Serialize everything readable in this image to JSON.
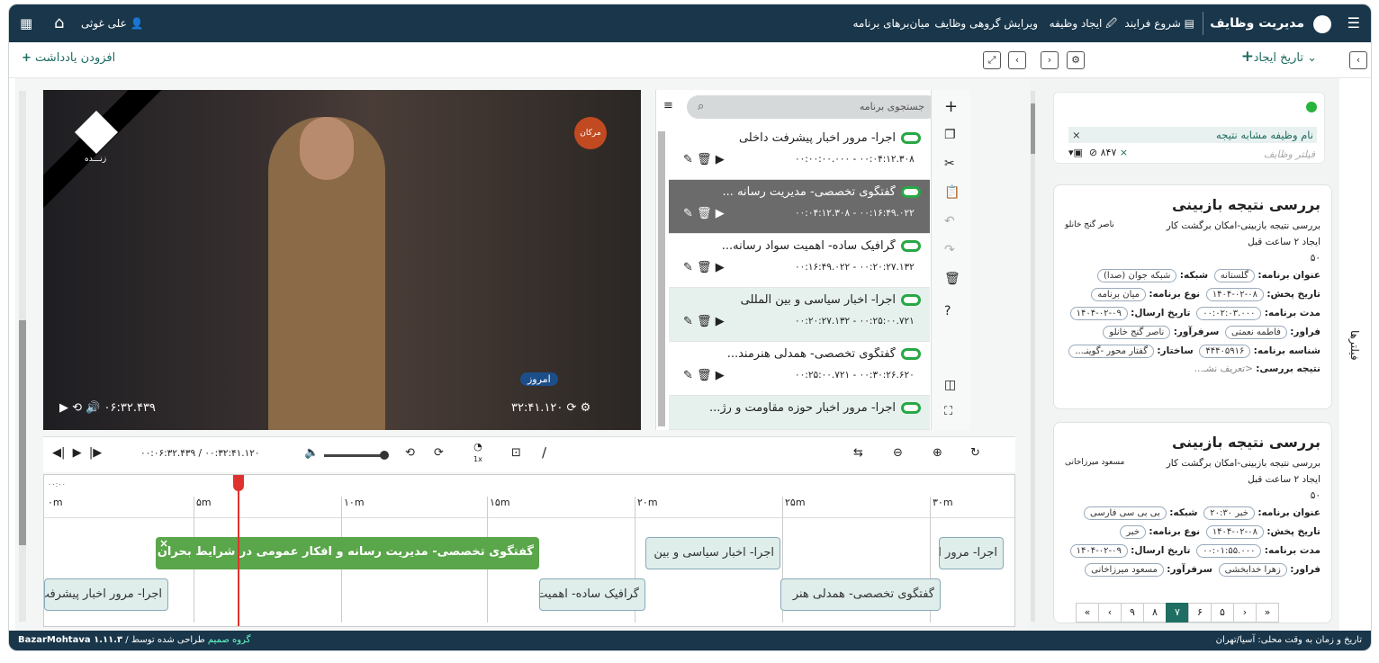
{
  "topbar": {
    "app_title": "مدیریت وظایف",
    "menu": [
      "شروع فرایند",
      "ایجاد وظیفه",
      "ویرایش گروهی وظایف",
      "میان‌برهای برنامه"
    ],
    "user": "علی غوثی"
  },
  "sub": {
    "sort_label": "تاریخ ایجاد",
    "add_note": "افزودن یادداشت"
  },
  "filters_rail": "فیلترها",
  "filter": {
    "tags": "نام وظیفه  مشابه  نتیجه",
    "placeholder": "فیلتر وظایف",
    "count": "۸۴۷"
  },
  "cards": [
    {
      "title": "بررسی نتیجه بازبینی",
      "subtitle": "بررسی نتیجه بازبینی-امکان برگشت کار",
      "person": "ناصر گنج خانلو",
      "created": "ایجاد ۲ ساعت قبل",
      "score": "۵۰",
      "l_program": "عنوان برنامه:",
      "v_program": "گلستانه",
      "l_network": "شبکه:",
      "v_network": "شبکه جوان (صدا)",
      "l_date": "تاریخ پخش:",
      "v_date": "۱۴۰۴-۰۲-۰۸",
      "l_type": "نوع برنامه:",
      "v_type": "میان برنامه",
      "l_dur": "مدت برنامه:",
      "v_dur": "۰۰:۰۲:۰۳.۰۰۰",
      "l_send": "تاریخ ارسال:",
      "v_send": "۱۴۰۴-۰۲-۰۹",
      "l_flow": "فراور:",
      "v_flow": "فاطمه نعمتی",
      "l_lead": "سرفرآور:",
      "v_lead": "ناصر گنج خانلو",
      "l_id": "شناسه برنامه:",
      "v_id": "۴۴۴۰۵۹۱۶",
      "l_struct": "ساختار:",
      "v_struct": "گفتار محور -گوینـ...",
      "l_result": "نتیجه بررسی:",
      "v_result": "<تعریف نشـ..."
    },
    {
      "title": "بررسی نتیجه بازبینی",
      "subtitle": "بررسی نتیجه بازبینی-امکان برگشت کار",
      "person": "مسعود میرزاخانی",
      "created": "ایجاد ۲ ساعت قبل",
      "score": "۵۰",
      "l_program": "عنوان برنامه:",
      "v_program": "خبر ۲۰:۳۰",
      "l_network": "شبکه:",
      "v_network": "بی بی سی فارسی",
      "l_date": "تاریخ پخش:",
      "v_date": "۱۴۰۴-۰۲-۰۸",
      "l_type": "نوع برنامه:",
      "v_type": "خبر",
      "l_dur": "مدت برنامه:",
      "v_dur": "۰۰:۰۱:۵۵.۰۰۰",
      "l_send": "تاریخ ارسال:",
      "v_send": "۱۴۰۴-۰۲-۰۹",
      "l_flow": "فراور:",
      "v_flow": "زهرا خدابخشی",
      "l_lead": "سرفرآور:",
      "v_lead": "مسعود میرزاخانی"
    }
  ],
  "pager": [
    "«",
    "‹",
    "۹",
    "۸",
    "۷",
    "۶",
    "۵",
    "›",
    "»"
  ],
  "video": {
    "live": "زنـــده",
    "time_left": "۰۶:۳۲.۴۳۹",
    "time_right": "۳۲:۴۱.۱۲۰",
    "logo_right": "مرکان",
    "logo_br": "امروز"
  },
  "search": {
    "placeholder": "جستجوی برنامه"
  },
  "playlist": [
    {
      "title": "اجرا- مرور اخبار پیشرفت داخلی",
      "time": "۰۰:۰۰:۰۰.۰۰۰  -  ۰۰:۰۴:۱۲.۳۰۸"
    },
    {
      "title": "گفتگوی تخصصی- مدیریت رسانه ...",
      "time": "۰۰:۰۴:۱۲.۳۰۸  -  ۰۰:۱۶:۴۹.۰۲۲"
    },
    {
      "title": "گرافیک ساده- اهمیت سواد رسانه...",
      "time": "۰۰:۱۶:۴۹.۰۲۲  -  ۰۰:۲۰:۲۷.۱۳۲"
    },
    {
      "title": "اجرا- اخبار سیاسی و بین المللی",
      "time": "۰۰:۲۰:۲۷.۱۳۲  -  ۰۰:۲۵:۰۰.۷۲۱"
    },
    {
      "title": "گفتگوی تخصصی- همدلی هنرمند...",
      "time": "۰۰:۲۵:۰۰.۷۲۱  -  ۰۰:۳۰:۲۶.۶۲۰"
    },
    {
      "title": "اجرا- مرور اخبار حوزه مقاومت و رژ...",
      "time": ""
    }
  ],
  "controls": {
    "time": "۰۰:۰۶:۳۲.۴۳۹ / ۰۰:۳۲:۴۱.۱۲۰",
    "speed": "1x"
  },
  "timeline": {
    "start": "۰۰:۰۰",
    "ticks": [
      "۰m",
      "۵m",
      "۱۰m",
      "۱۵m",
      "۲۰m",
      "۲۵m",
      "۳۰m"
    ],
    "segs": [
      "گفتگوی تخصصی- مدیریت رسانه و افکار عمومی در شرایط بحران",
      "اجرا- اخبار سیاسی و بین",
      "اجرا- مرور ا",
      "اجرا- مرور اخبار پیشرفت",
      "گرافیک ساده- اهمیت",
      "گفتگوی تخصصی- همدلی هنر"
    ]
  },
  "footer": {
    "left": "BazarMohtava ۱.۱۱.۳",
    "left2": "گروه صمیم",
    "left3": "طراحی شده توسط",
    "right": "تاریخ و زمان به وقت محلی: آسیا/تهران"
  }
}
